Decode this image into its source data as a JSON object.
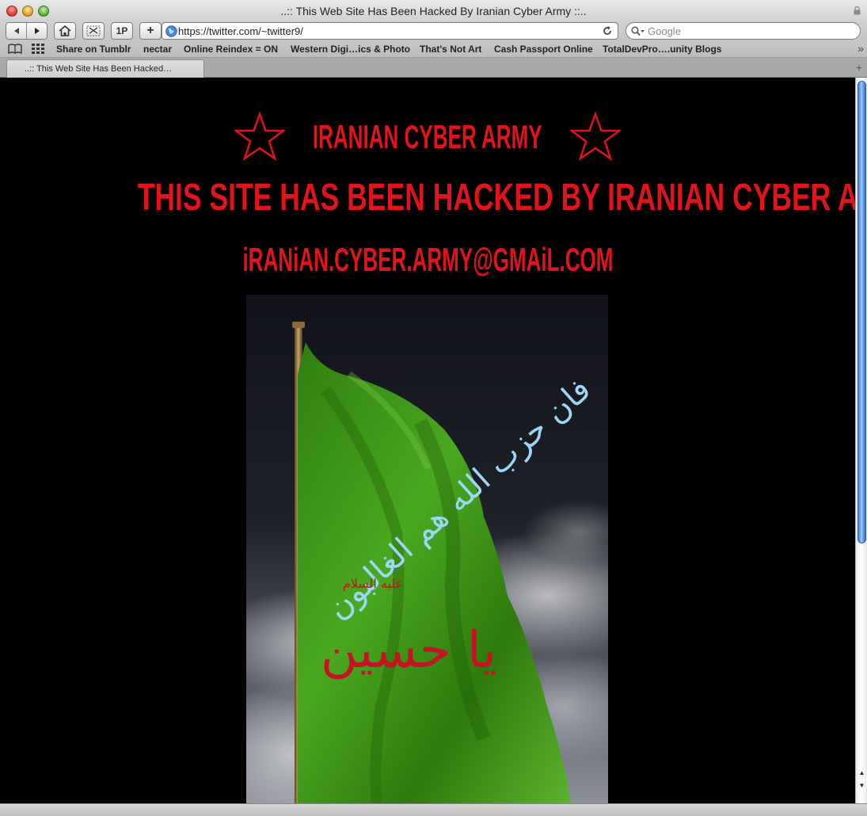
{
  "window": {
    "title": "..:: This Web Site Has Been Hacked By Iranian Cyber Army ::.."
  },
  "toolbar": {
    "onep_label": "1P",
    "add_label": "+",
    "url": "https://twitter.com/~twitter9/",
    "search_placeholder": "Google"
  },
  "bookmarks": [
    "Share on Tumblr",
    "nectar",
    "Online Reindex = ON",
    "Western Digi…ics & Photo",
    "That's Not Art",
    "Cash Passport Online",
    "TotalDevPro….unity Blogs"
  ],
  "tab": {
    "label": "..:: This Web Site Has Been Hacked…"
  },
  "page": {
    "heading": "IRANIAN CYBER ARMY",
    "message": "THIS SITE HAS BEEN HACKED BY IRANIAN CYBER ARMY",
    "email": "iRANiAN.CYBER.ARMY@GMAiL.COM",
    "banner_lettering": "فان حزب الله هم الغالبون",
    "flag_lettering": "يا حسين",
    "flag_sublettering": "عليه السلام"
  },
  "colors": {
    "accent_red": "#e0141c",
    "page_bg": "#000000",
    "flag_green": "#3c9a17",
    "script_blue": "#8fd0f0"
  }
}
